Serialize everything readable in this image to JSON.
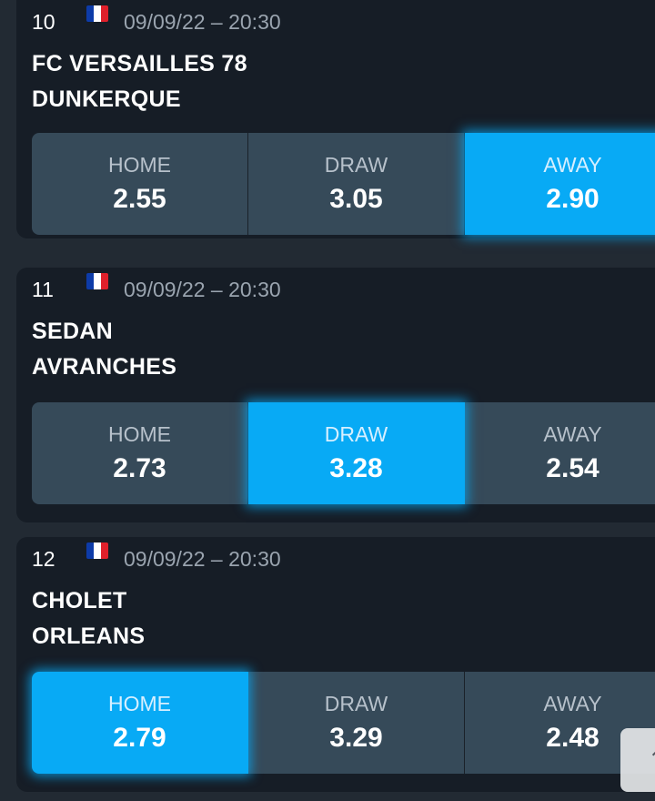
{
  "flag_colors": [
    "#0d3ba8",
    "#ffffff",
    "#e0202b"
  ],
  "accent_color": "#08aaf5",
  "matches": [
    {
      "number": "10",
      "flag": "france-flag-icon",
      "datetime": "09/09/22 – 20:30",
      "home_team": "FC VERSAILLES 78",
      "away_team": "DUNKERQUE",
      "odds": [
        {
          "label": "HOME",
          "value": "2.55",
          "selected": false
        },
        {
          "label": "DRAW",
          "value": "3.05",
          "selected": false
        },
        {
          "label": "AWAY",
          "value": "2.90",
          "selected": true
        }
      ]
    },
    {
      "number": "11",
      "flag": "france-flag-icon",
      "datetime": "09/09/22 – 20:30",
      "home_team": "SEDAN",
      "away_team": "AVRANCHES",
      "odds": [
        {
          "label": "HOME",
          "value": "2.73",
          "selected": false
        },
        {
          "label": "DRAW",
          "value": "3.28",
          "selected": true
        },
        {
          "label": "AWAY",
          "value": "2.54",
          "selected": false
        }
      ]
    },
    {
      "number": "12",
      "flag": "france-flag-icon",
      "datetime": "09/09/22 – 20:30",
      "home_team": "CHOLET",
      "away_team": "ORLEANS",
      "odds": [
        {
          "label": "HOME",
          "value": "2.79",
          "selected": true
        },
        {
          "label": "DRAW",
          "value": "3.29",
          "selected": false
        },
        {
          "label": "AWAY",
          "value": "2.48",
          "selected": false
        }
      ]
    }
  ],
  "scroll_top": {
    "icon": "arrow-up-icon",
    "glyph": "↑"
  }
}
